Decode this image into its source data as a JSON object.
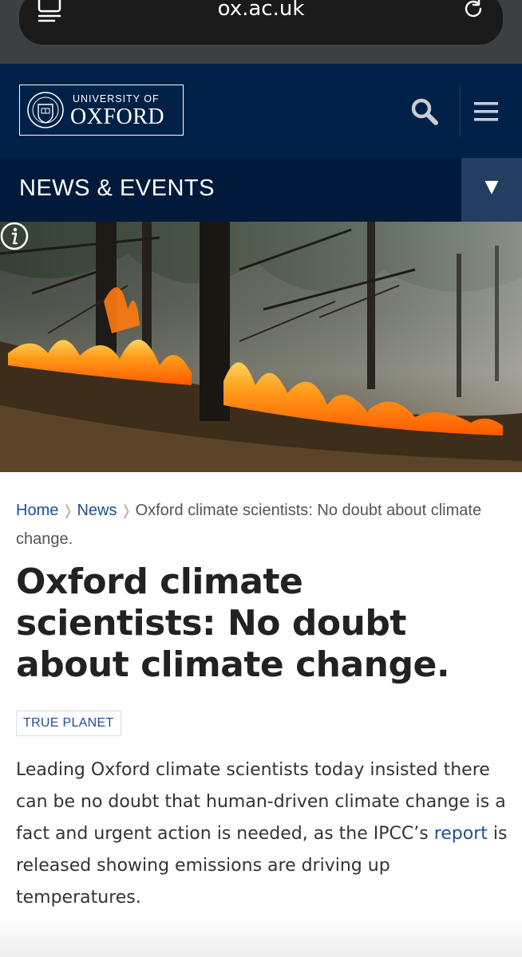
{
  "browser": {
    "url": "ox.ac.uk",
    "tabs_icon": "tabs-icon",
    "reload_icon": "reload-icon"
  },
  "header": {
    "logo_line1": "UNIVERSITY OF",
    "logo_line2": "OXFORD",
    "search_icon": "search-icon",
    "menu_icon": "hamburger-menu-icon",
    "bg_color": "#002147"
  },
  "section": {
    "title": "NEWS & EVENTS",
    "toggle_glyph": "▼"
  },
  "hero": {
    "info_icon": "info-icon"
  },
  "breadcrumb": {
    "home": "Home",
    "news": "News",
    "current": "Oxford climate scientists: No doubt about climate change."
  },
  "article": {
    "title": "Oxford climate scientists: No doubt about climate change.",
    "tag": "TRUE PLANET",
    "lead_before": "Leading Oxford climate scientists today insisted there can be no doubt that human-driven climate change is a fact and urgent action is needed, as the IPCC’s ",
    "lead_link": "report",
    "lead_after": " is released showing emissions are driving up temperatures."
  },
  "colors": {
    "link": "#1d4f91",
    "oxford_blue": "#002147"
  }
}
